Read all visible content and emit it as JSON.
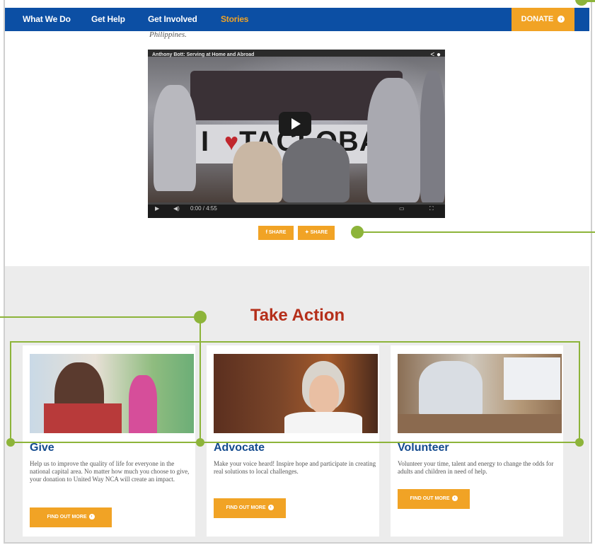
{
  "nav": {
    "items": [
      {
        "label": "What We Do"
      },
      {
        "label": "Get Help"
      },
      {
        "label": "Get Involved"
      },
      {
        "label": "Stories"
      }
    ],
    "donate_label": "DONATE"
  },
  "stories": {
    "caption_tail": "Philippines.",
    "video": {
      "title": "Anthony Bott: Serving at Home and Abroad",
      "sign_text": "TACLOBAN",
      "time_label": "0:00 / 4:55"
    },
    "share_buttons": [
      {
        "label": "SHARE",
        "icon": "facebook-icon"
      },
      {
        "label": "SHARE",
        "icon": "twitter-icon"
      }
    ]
  },
  "take_action": {
    "title": "Take Action",
    "cards": [
      {
        "heading": "Give",
        "description": "Help us to improve the quality of life for everyone in the national capital area. No matter how much you choose to give, your donation to United Way NCA will create an impact.",
        "button_label": "FIND OUT MORE"
      },
      {
        "heading": "Advocate",
        "description": "Make your voice heard! Inspire hope and participate in creating real solutions to local challenges.",
        "button_label": "FIND OUT MORE"
      },
      {
        "heading": "Volunteer",
        "description": "Volunteer your time, talent and energy to change the odds for adults and children in need of help.",
        "button_label": "FIND OUT MORE"
      }
    ]
  },
  "colors": {
    "nav_blue": "#0c4fa4",
    "accent_orange": "#f1a325",
    "title_red": "#b52f1a",
    "heading_blue": "#134a8e",
    "callout_green": "#8db43a"
  }
}
